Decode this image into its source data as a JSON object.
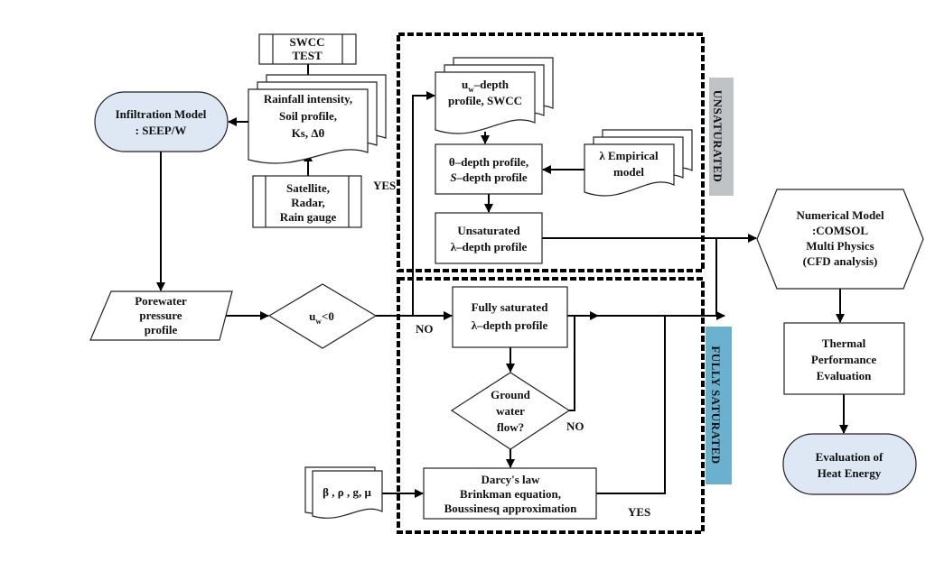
{
  "nodes": {
    "infiltration_model": [
      "Infiltration Model",
      ": SEEP/W"
    ],
    "swcc_test": [
      "SWCC",
      "TEST"
    ],
    "rainfall_inputs": [
      "Rainfall intensity,",
      "Soil profile,",
      "Ks, Δθ"
    ],
    "rain_sources": [
      "Satellite,",
      "Radar,",
      "Rain gauge"
    ],
    "porewater_profile": [
      "Porewater",
      "pressure",
      "profile"
    ],
    "uw_decision": {
      "base": "u",
      "sub": "w",
      "rest": "<0"
    },
    "uw_depth": {
      "base": "u",
      "sub": "w",
      "rest": "–depth",
      "line2": "profile, SWCC"
    },
    "theta_depth": {
      "line1": "θ–depth profile,",
      "italic": "S",
      "line2_rest": "–depth profile"
    },
    "lambda_empirical": [
      "λ Empirical",
      "model"
    ],
    "unsaturated_lambda": [
      "Unsaturated",
      "λ–depth profile"
    ],
    "fully_saturated_lambda": [
      "Fully saturated",
      "λ–depth profile"
    ],
    "groundwater_decision": [
      "Ground",
      "water",
      "flow?"
    ],
    "darcy": [
      "Darcy's law",
      "Brinkman equation,",
      "Boussinesq approximation"
    ],
    "fluid_params": "β , ρ , g, μ",
    "numerical_model": [
      "Numerical Model",
      ":COMSOL",
      "Multi Physics",
      "(CFD analysis)"
    ],
    "thermal_evaluation": [
      "Thermal",
      "Performance",
      "Evaluation"
    ],
    "heat_energy": [
      "Evaluation of",
      "Heat Energy"
    ]
  },
  "edge_labels": {
    "uw_yes": "YES",
    "uw_no": "NO",
    "gw_no": "NO",
    "gw_yes": "YES"
  },
  "regions": {
    "unsaturated": "UNSATURATED",
    "fully_saturated": "FULLY SATURATED"
  },
  "colors": {
    "terminal_fill": "#dde8f4",
    "unsaturated_label": "#c0c3c6",
    "saturated_label": "#6ab1cf"
  }
}
